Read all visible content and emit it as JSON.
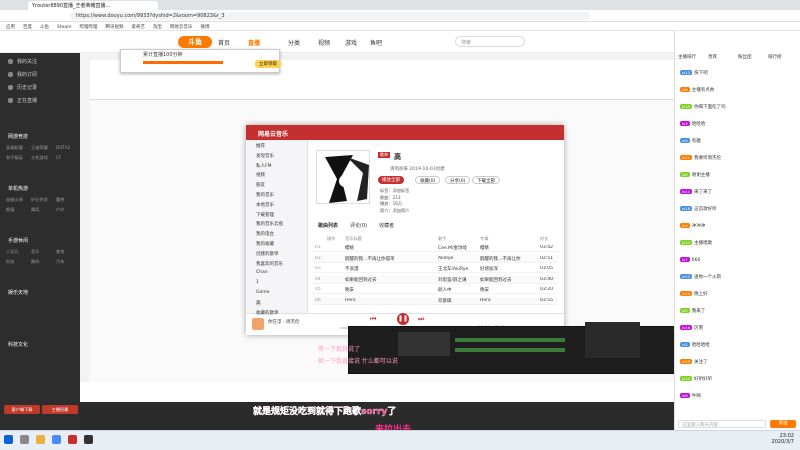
{
  "browser": {
    "tab_title": "Yrouter8890直播_王者荣耀直播...",
    "url": "https://www.douyu.com/9933?dyshid=2&room=90823&r_3",
    "bookmarks": [
      "应用",
      "百度",
      "斗鱼",
      "Steam",
      "哔哩哔哩",
      "腾讯视频",
      "爱奇艺",
      "淘宝",
      "网易云音乐",
      "微博"
    ]
  },
  "site": {
    "logo": "斗鱼",
    "nav": [
      "首页",
      "直播",
      "分类",
      "视频",
      "游戏",
      "鱼吧"
    ],
    "search_placeholder": "搜索"
  },
  "sidebar": {
    "items": [
      "我的关注",
      "我的订阅",
      "历史记录",
      "正在直播"
    ],
    "sections": [
      "网游竞技",
      "单机热游",
      "手游休闲",
      "娱乐天地",
      "科技文化"
    ],
    "grid": [
      "英雄联盟",
      "王者荣耀",
      "DOTA2",
      "和平精英",
      "主机游戏",
      "CF",
      "穿越火线",
      "炉石传说",
      "魔兽",
      "颜值",
      "舞蹈",
      "户外",
      "二次元",
      "音乐",
      "美食",
      "科技",
      "数码",
      "汽车"
    ],
    "footer_buttons": [
      "客户端下载",
      "主播招募"
    ]
  },
  "popup": {
    "title": "累计直播100分钟",
    "button": "立即领取"
  },
  "music": {
    "app_name": "网易云音乐",
    "playlist_tag": "歌单",
    "playlist_title": "高",
    "creator": "清风徐来 2019-10-03创建",
    "buttons": [
      "播放全部",
      "收藏(0)",
      "分享(0)",
      "下载全部"
    ],
    "meta": [
      "标签：添加标签",
      "歌曲：213",
      "播放：16万",
      "简介：添加简介"
    ],
    "side_items": [
      "推荐",
      "发现音乐",
      "私人FM",
      "视频",
      "朋友",
      "我的音乐",
      "本地音乐",
      "下载管理",
      "我的音乐云盘",
      "我的电台",
      "我的收藏",
      "创建的歌单",
      "我喜欢的音乐",
      "Chan",
      "1",
      "Game",
      "高",
      "收藏的歌单"
    ],
    "tabs": [
      "歌曲列表",
      "评论(0)",
      "收藏者"
    ],
    "columns": [
      "操作",
      "音乐标题",
      "歌手",
      "专辑",
      "时长"
    ],
    "rows": [
      [
        "01",
        "樱桃",
        "Cee.M/金玟岐",
        "樱桃",
        "03:42"
      ],
      [
        "02",
        "醉醒的我…不再让你孤单",
        "AkiRye",
        "醉醒的我…不再让你",
        "02:51"
      ],
      [
        "03",
        "不浪漫",
        "王北车/AkiRye",
        "好感加深",
        "03:05"
      ],
      [
        "04",
        "如果能回到过去",
        "刘思鉴/薛之谦",
        "如果能回到过去",
        "03:40"
      ],
      [
        "05",
        "晚安",
        "颜人中",
        "晚安",
        "03:20"
      ],
      [
        "06",
        "Hero",
        "邓紫棋",
        "Hero",
        "03:55"
      ]
    ],
    "now_playing": "你在浮 - 周杰伦",
    "time": "00:00 / 03:42"
  },
  "overlay": {
    "subtitle_line1": "就是规矩没吃到就得下跑歌sorry了",
    "subtitle_line2": "来拉出去",
    "faded_line1": "等一下我就说了",
    "faded_line2": "就一下我直接说 什么都可以说"
  },
  "chat": {
    "header": [
      "主播排行",
      "贵宾",
      "粉丝团",
      "排行榜"
    ],
    "messages": [
      [
        "lv12",
        "快下吧"
      ],
      [
        "lv8",
        "主播有点帅"
      ],
      [
        "lv15",
        "你喝下面吃了吗"
      ],
      [
        "lv3",
        "哈哈哈"
      ],
      [
        "lv9",
        "有趣"
      ],
      [
        "lv21",
        "我要听周杰伦"
      ],
      [
        "lv6",
        "谢谢主播"
      ],
      [
        "lv11",
        "来了来了"
      ],
      [
        "lv18",
        "这首歌好听"
      ],
      [
        "lv4",
        "冲冲冲"
      ],
      [
        "lv13",
        "主播唱歌"
      ],
      [
        "lv7",
        "666"
      ],
      [
        "lv22",
        "送你一个火箭"
      ],
      [
        "lv10",
        "晚上好"
      ],
      [
        "lv5",
        "我来了"
      ],
      [
        "lv16",
        "厉害"
      ],
      [
        "lv2",
        "哈哈哈哈"
      ],
      [
        "lv19",
        "关注了"
      ],
      [
        "lv14",
        "好听好听"
      ],
      [
        "lv8",
        "牛啊"
      ]
    ],
    "input_placeholder": "这里输入聊天内容",
    "send": "发送"
  },
  "taskbar": {
    "time": "23:02",
    "date": "2020/3/7"
  },
  "colors": {
    "douyu_orange": "#ff7a00",
    "netease_red": "#c62f2f",
    "subtitle_pink": "#ff2e8a"
  }
}
